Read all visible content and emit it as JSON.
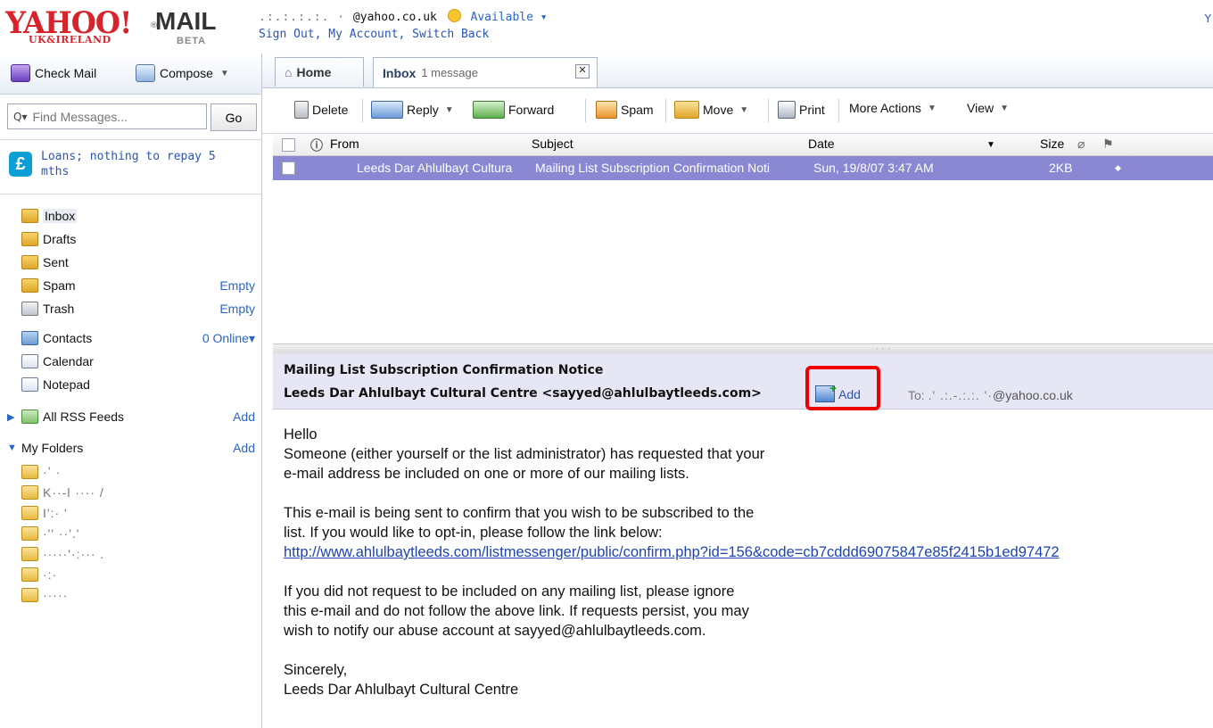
{
  "header": {
    "logo_yahoo": "YAHOO!",
    "logo_mail": "MAIL",
    "logo_region": "UK&IRELAND",
    "logo_beta": "BETA",
    "user_email": "@yahoo.co.uk",
    "status": "Available",
    "account_links": "Sign Out, My Account, Switch Back",
    "top_right_letter": "Y"
  },
  "left": {
    "check_mail": "Check Mail",
    "compose": "Compose",
    "search_placeholder": "Find Messages...",
    "go": "Go",
    "ad_text": "Loans; nothing to repay 5 mths",
    "folders": [
      {
        "label": "Inbox",
        "right": ""
      },
      {
        "label": "Drafts",
        "right": ""
      },
      {
        "label": "Sent",
        "right": ""
      },
      {
        "label": "Spam",
        "right": "Empty"
      },
      {
        "label": "Trash",
        "right": "Empty"
      }
    ],
    "contacts": "Contacts",
    "contacts_status": "0 Online",
    "calendar": "Calendar",
    "notepad": "Notepad",
    "rss": "All RSS Feeds",
    "rss_add": "Add",
    "my_folders": "My Folders",
    "my_folders_add": "Add"
  },
  "tabs": {
    "home": "Home",
    "inbox": "Inbox",
    "inbox_count": "1 message"
  },
  "toolbar": {
    "delete": "Delete",
    "reply": "Reply",
    "forward": "Forward",
    "spam": "Spam",
    "move": "Move",
    "print": "Print",
    "more_actions": "More Actions",
    "view": "View"
  },
  "list": {
    "columns": [
      "From",
      "Subject",
      "Date",
      "Size"
    ],
    "rows": [
      {
        "from": "Leeds Dar Ahlulbayt Cultura",
        "subject": "Mailing List Subscription Confirmation Noti",
        "date": "Sun, 19/8/07 3:47 AM",
        "size": "2KB"
      }
    ]
  },
  "message": {
    "subject": "Mailing List Subscription Confirmation Notice",
    "from": "Leeds Dar Ahlulbayt Cultural Centre <sayyed@ahlulbaytleeds.com>",
    "add_label": "Add",
    "to_label": "To:",
    "to_value": "@yahoo.co.uk",
    "body_1": "Hello",
    "body_2": "Someone (either yourself or the list administrator) has requested that your",
    "body_3": "e-mail address be included on one or more of our mailing lists.",
    "body_4": "This e-mail is being sent to confirm that you wish to be subscribed to the",
    "body_5": "list. If you would like to opt-in, please follow the link below:",
    "link": "http://www.ahlulbaytleeds.com/listmessenger/public/confirm.php?id=156&code=cb7cddd69075847e85f2415b1ed97472",
    "body_6": "If you did not request to be included on any mailing list, please ignore",
    "body_7": "this e-mail and do not follow the above link. If requests persist, you may",
    "body_8": "wish to notify our abuse account at sayyed@ahlulbaytleeds.com.",
    "body_9": "Sincerely,",
    "body_10": "Leeds Dar Ahlulbayt Cultural Centre"
  },
  "colors": {
    "selected_row": "#8a88d3",
    "link": "#1d43b3",
    "highlight_box": "#ee0000"
  }
}
